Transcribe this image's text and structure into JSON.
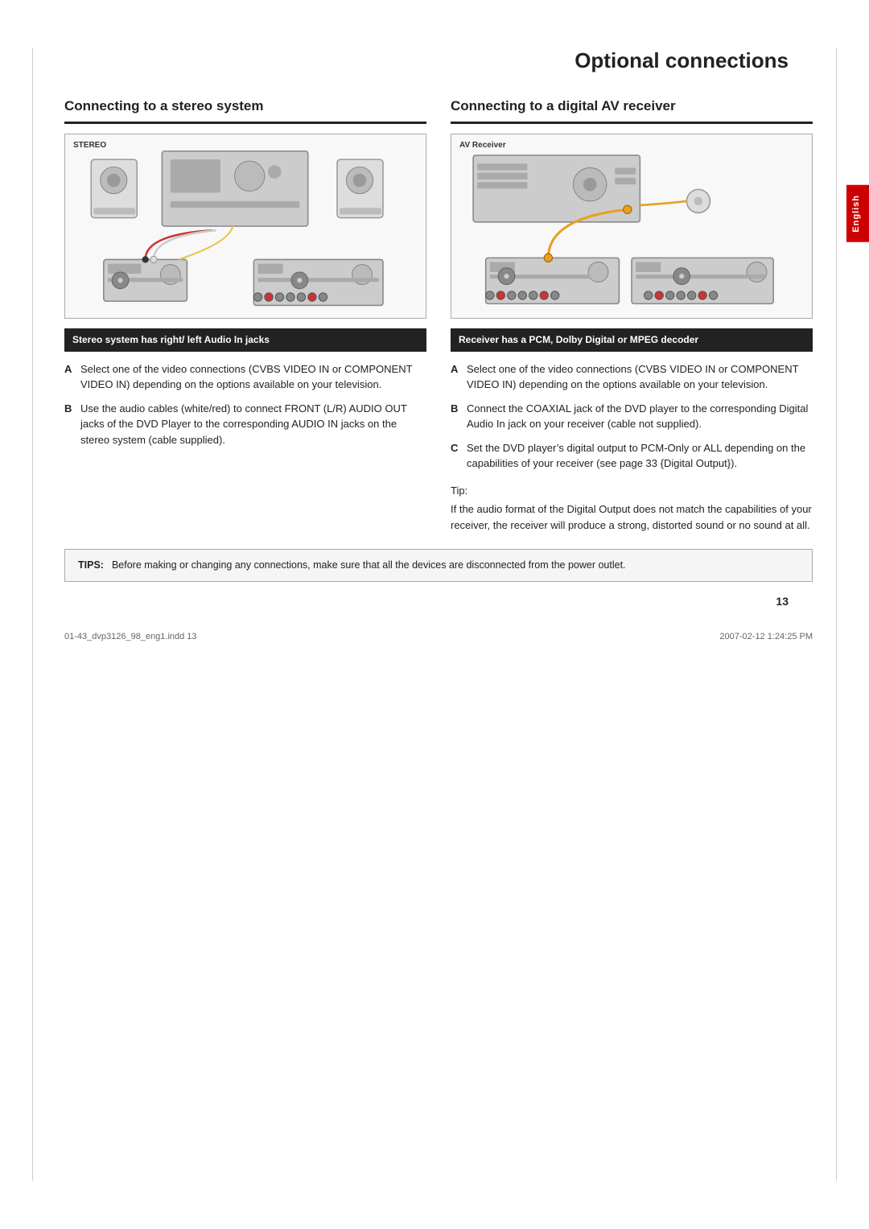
{
  "page": {
    "title": "Optional connections",
    "page_number": "13",
    "footer_left": "01-43_dvp3126_98_eng1.indd  13",
    "footer_right": "2007-02-12  1:24:25 PM"
  },
  "english_tab": "English",
  "left_section": {
    "heading": "Connecting to a stereo system",
    "diagram_label": "STEREO",
    "info_box": "Stereo system has right/ left Audio In jacks",
    "steps": [
      {
        "letter": "A",
        "text": "Select one of the video connections (CVBS VIDEO IN or COMPONENT VIDEO IN) depending on the options available on your television."
      },
      {
        "letter": "B",
        "text": "Use the audio cables (white/red) to connect FRONT (L/R) AUDIO OUT jacks of the DVD Player to the corresponding AUDIO IN jacks on the stereo system (cable supplied)."
      }
    ]
  },
  "right_section": {
    "heading": "Connecting to a digital AV receiver",
    "diagram_label": "AV Receiver",
    "info_box": "Receiver has a PCM, Dolby Digital or MPEG decoder",
    "steps": [
      {
        "letter": "A",
        "text": "Select one of the video connections (CVBS VIDEO IN or COMPONENT VIDEO IN) depending on the options available on your television."
      },
      {
        "letter": "B",
        "text": "Connect the COAXIAL jack of the DVD player to the corresponding Digital Audio In jack on your receiver (cable not supplied)."
      },
      {
        "letter": "C",
        "text": "Set the DVD player’s digital output to PCM-Only or ALL depending on the capabilities of your receiver (see page 33 {Digital Output})."
      }
    ],
    "tip_label": "Tip:",
    "tip_text": "If the audio format of the Digital Output does not match the capabilities of your receiver, the receiver will produce a strong, distorted sound or no sound at all."
  },
  "bottom_tips": {
    "label": "TIPS:",
    "text": "Before making or changing any connections, make sure that all the devices are disconnected from the power outlet."
  }
}
